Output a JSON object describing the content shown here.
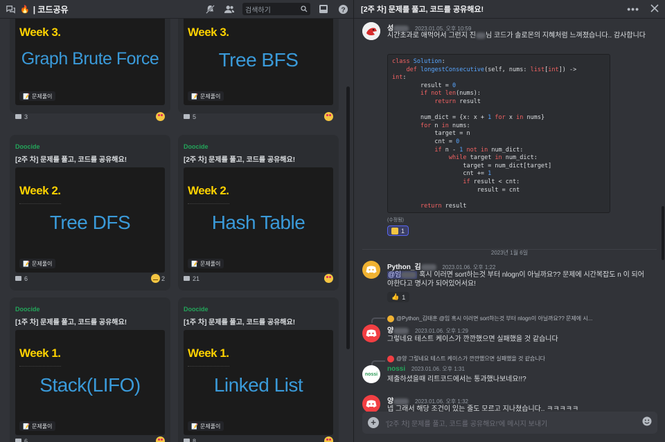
{
  "left": {
    "channel_name": "| 코드공유",
    "search_placeholder": "검색하기",
    "cards": [
      {
        "tag": "",
        "title": "",
        "week": "Week 3.",
        "topic": "Graph Brute Force",
        "chip": "문제풀이",
        "comments": "3",
        "reaction_count": "",
        "reaction": "heart-eyes"
      },
      {
        "tag": "",
        "title": "",
        "week": "Week 3.",
        "topic": "Tree BFS",
        "chip": "문제풀이",
        "comments": "5",
        "reaction_count": "",
        "reaction": "heart-eyes"
      },
      {
        "tag": "Doocide",
        "title": "[2주 차] 문제를 풀고, 코드를 공유해요!",
        "week": "Week 2.",
        "topic": "Tree DFS",
        "chip": "문제풀이",
        "comments": "6",
        "reaction_count": "2",
        "reaction": "slant-face"
      },
      {
        "tag": "Doocide",
        "title": "[2주 차] 문제를 풀고, 코드를 공유해요!",
        "week": "Week 2.",
        "topic": "Hash Table",
        "chip": "문제풀이",
        "comments": "21",
        "reaction_count": "",
        "reaction": "heart-eyes"
      },
      {
        "tag": "Doocide",
        "title": "[1주 차] 문제를 풀고, 코드를 공유해요!",
        "week": "Week 1.",
        "topic": "Stack(LIFO)",
        "chip": "문제풀이",
        "comments": "6",
        "reaction_count": "",
        "reaction": "heart-eyes"
      },
      {
        "tag": "Doocide",
        "title": "[1주 차] 문제를 풀고, 코드를 공유해요!",
        "week": "Week 1.",
        "topic": "Linked List",
        "chip": "문제풀이",
        "comments": "8",
        "reaction_count": "",
        "reaction": "heart-eyes"
      }
    ]
  },
  "thread": {
    "title": "[2주 차] 문제를 풀고, 코드를 공유해요!",
    "messages": {
      "m1": {
        "user": "성",
        "time": "2023.01.05. 오후 10:59",
        "text_a": "시간초과로 애먹어서 그런지 진",
        "text_b": "님 코드가 솔로몬의 지혜처럼 느껴졌습니다.. 감사합니다",
        "edited": "(수정됨)",
        "reaction_count": "1"
      },
      "m2": {
        "user": "Python_김",
        "time": "2023.01.06. 오후 1:22",
        "mention": "@임",
        "text": " 혹시 이러면 sort하는것 부터 nlogn이 아닐까요?? 문제에 시간복잡도 n 이 되어야한다고 명시가 되어있어서요!",
        "reaction_count": "1"
      },
      "m3": {
        "reply": "@Python_김태훈 @임 혹시 이러면 sort하는것 부터 nlogn이 아닐까요?? 문제에 시...",
        "user": "양",
        "time": "2023.01.06. 오후 1:29",
        "text": "그렇네요 테스트 케이스가 깐깐했으면 실패했을 것 같습니다"
      },
      "m4": {
        "reply": "@양 그렇네요 테스트 케이스가 깐깐했으면 실패했을 것 같습니다",
        "user": "nossi",
        "time": "2023.01.06. 오후 1:31",
        "text": "제출하셨을때 리트코드에서는 통과했나보네요!!?"
      },
      "m5": {
        "user": "양",
        "time": "2023.01.06. 오후 1:32",
        "text": "넵 그래서 해당 조건이 있는 줄도 모르고 지나쳤습니다.. ㅋㅋㅋㅋㅋ"
      }
    },
    "date_divider": "2023년 1월 6일",
    "composer_placeholder": "'[2주 차] 문제를 풀고, 코드를 공유해요!'에 메시지 보내기"
  },
  "colors": {
    "accent": "#5865f2",
    "tag_green": "#23a55a",
    "week_yellow": "#ffd200",
    "topic_blue": "#3a9ad9"
  }
}
